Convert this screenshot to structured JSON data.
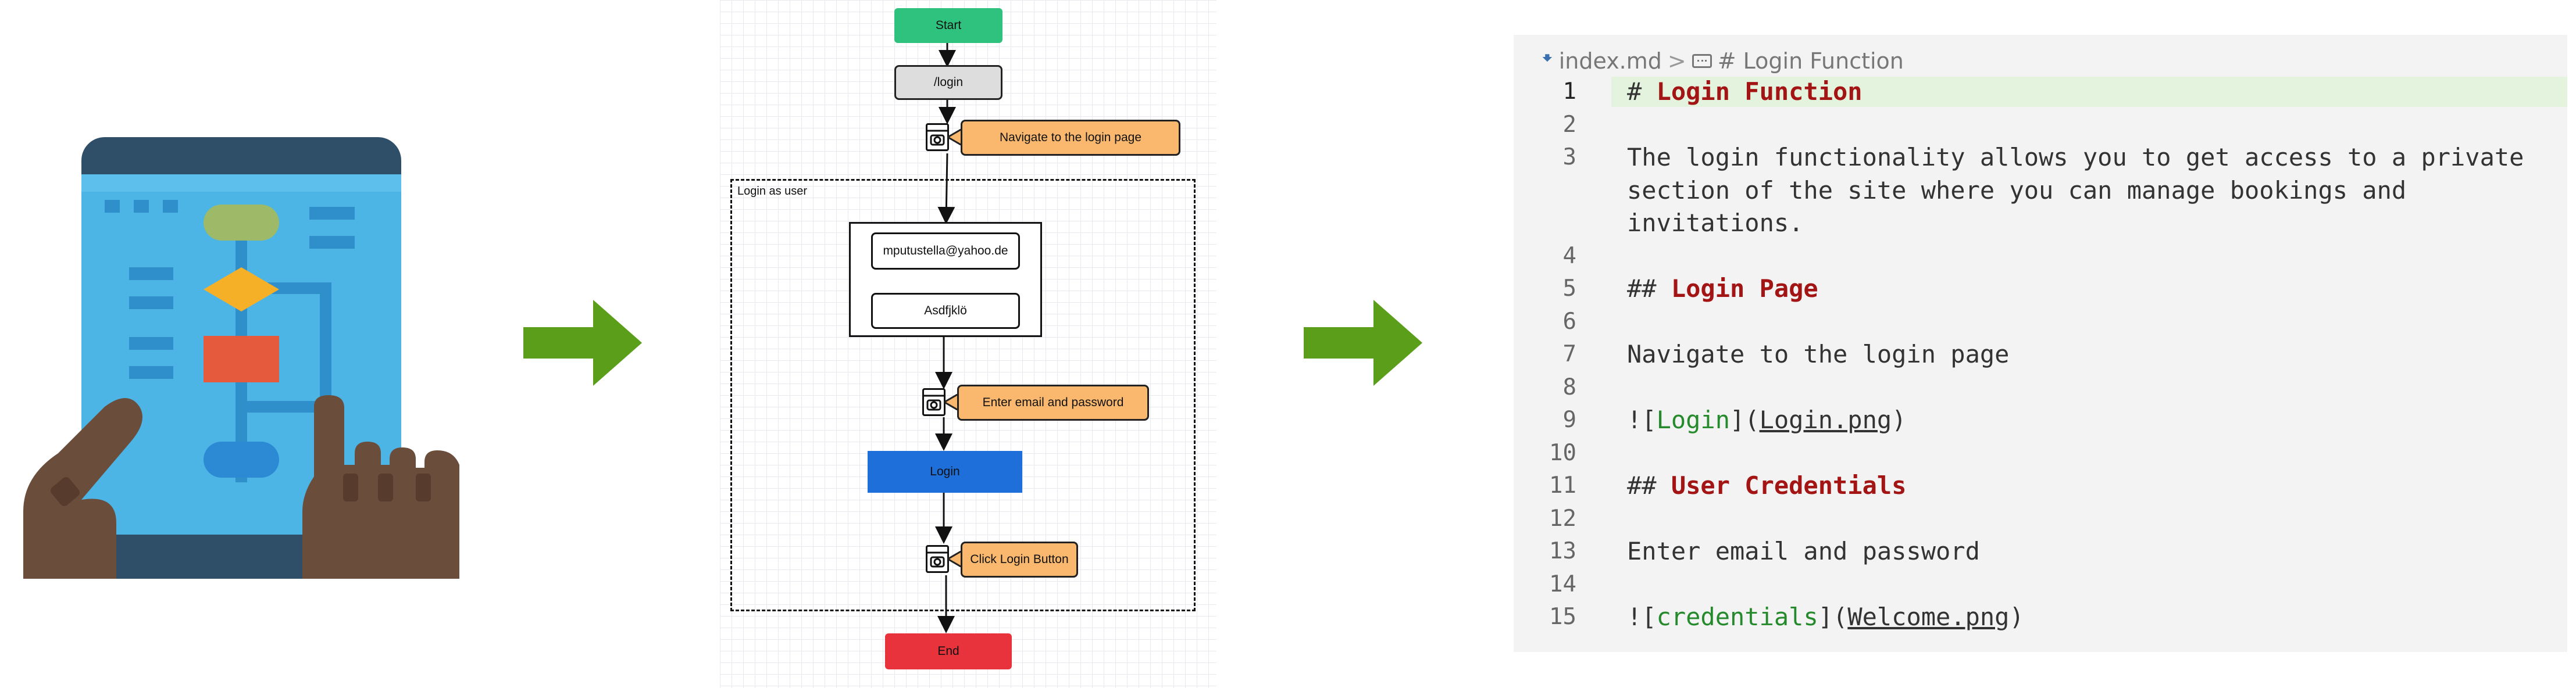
{
  "flowchart": {
    "start": "Start",
    "login_route": "/login",
    "step1_note": "Navigate to the login page",
    "group_label": "Login as user",
    "email_value": "mputustella@yahoo.de",
    "password_value": "Asdfjklö",
    "step2_note": "Enter email and password",
    "login_button": "Login",
    "step3_note": "Click Login Button",
    "end": "End",
    "colors": {
      "start": "#2ec27e",
      "login_route": "#dddddd",
      "note": "#f9b86e",
      "login_button": "#1e6fd9",
      "end": "#e8333c"
    }
  },
  "editor": {
    "breadcrumb": {
      "file": "index.md",
      "symbol": "# Login Function"
    },
    "lines": [
      {
        "n": "1",
        "parts": [
          {
            "t": "# ",
            "c": "hash"
          },
          {
            "t": "Login Function",
            "c": "hd"
          }
        ]
      },
      {
        "n": "2",
        "parts": []
      },
      {
        "n": "3",
        "parts": [
          {
            "t": "The login functionality allows you to get access to a private",
            "c": ""
          }
        ]
      },
      {
        "n": "",
        "parts": [
          {
            "t": "section of the site where you can manage bookings and",
            "c": ""
          }
        ]
      },
      {
        "n": "",
        "parts": [
          {
            "t": "invitations.",
            "c": ""
          }
        ]
      },
      {
        "n": "4",
        "parts": []
      },
      {
        "n": "5",
        "parts": [
          {
            "t": "## ",
            "c": "hash"
          },
          {
            "t": "Login Page",
            "c": "hd"
          }
        ]
      },
      {
        "n": "6",
        "parts": []
      },
      {
        "n": "7",
        "parts": [
          {
            "t": "Navigate to the login page",
            "c": ""
          }
        ]
      },
      {
        "n": "8",
        "parts": []
      },
      {
        "n": "9",
        "parts": [
          {
            "t": "![",
            "c": "lbr"
          },
          {
            "t": "Login",
            "c": "alt"
          },
          {
            "t": "](",
            "c": "lbr"
          },
          {
            "t": "Login.png",
            "c": "url"
          },
          {
            "t": ")",
            "c": "lbr"
          }
        ]
      },
      {
        "n": "10",
        "parts": []
      },
      {
        "n": "11",
        "parts": [
          {
            "t": "## ",
            "c": "hash"
          },
          {
            "t": "User Credentials",
            "c": "hd"
          }
        ]
      },
      {
        "n": "12",
        "parts": []
      },
      {
        "n": "13",
        "parts": [
          {
            "t": "Enter email and password",
            "c": ""
          }
        ]
      },
      {
        "n": "14",
        "parts": []
      },
      {
        "n": "15",
        "parts": [
          {
            "t": "![",
            "c": "lbr"
          },
          {
            "t": "credentials",
            "c": "alt"
          },
          {
            "t": "](",
            "c": "lbr"
          },
          {
            "t": "Welcome.png",
            "c": "url"
          },
          {
            "t": ")",
            "c": "lbr"
          }
        ]
      }
    ]
  }
}
